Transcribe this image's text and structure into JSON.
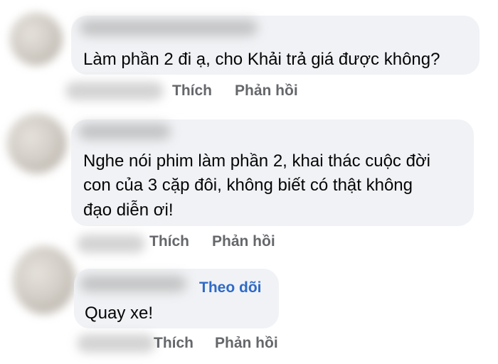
{
  "comments": [
    {
      "lines": [
        "Làm phần 2 đi ạ, cho Khải trả giá được không?"
      ],
      "like_label": "Thích",
      "reply_label": "Phản hồi"
    },
    {
      "lines": [
        "Nghe nói phim làm phần 2, khai thác cuộc đời",
        "con của 3 cặp đôi, không biết có thật không",
        "đạo diễn ơi!"
      ],
      "like_label": "Thích",
      "reply_label": "Phản hồi"
    },
    {
      "follow_label": "Theo dõi",
      "lines": [
        "Quay xe!"
      ],
      "like_label": "Thích",
      "reply_label": "Phản hồi"
    }
  ],
  "colors": {
    "bubble": "#f0f2f5",
    "text": "#050505",
    "action": "#65676b",
    "follow": "#2f6ac7"
  }
}
